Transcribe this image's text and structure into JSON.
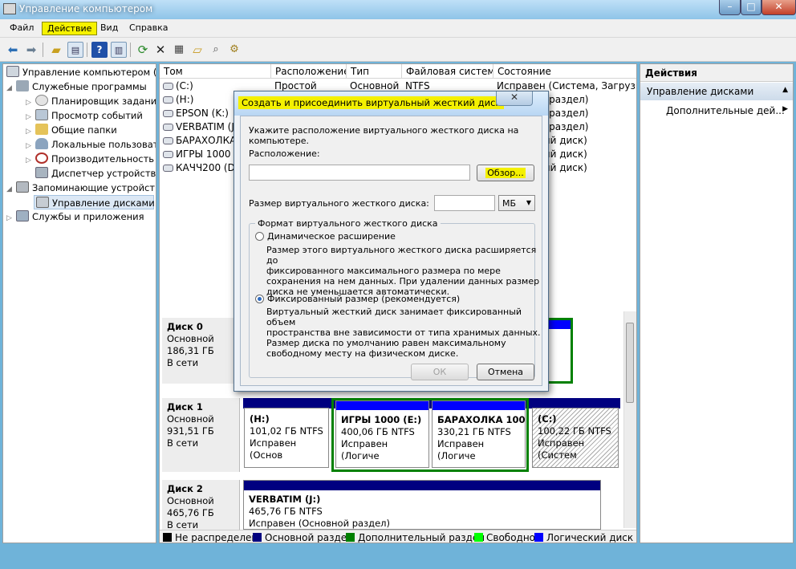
{
  "window": {
    "title": "Управление компьютером",
    "controls": {
      "minimize": "–",
      "maximize": "□",
      "close": "✕"
    }
  },
  "menu": [
    "Файл",
    "Действие",
    "Вид",
    "Справка"
  ],
  "toolbar": {
    "icons": [
      "back-icon",
      "forward-icon",
      "up-folder-icon",
      "show-tree-icon",
      "help-icon",
      "show-action-pane-icon",
      "refresh-icon",
      "delete-icon",
      "properties-icon",
      "open-folder-icon",
      "search-disk-icon",
      "disk-settings-icon"
    ]
  },
  "tree": {
    "root": "Управление компьютером (л",
    "items": [
      {
        "label": "Служебные программы",
        "level": 1
      },
      {
        "label": "Планировщик заданий",
        "level": 2
      },
      {
        "label": "Просмотр событий",
        "level": 2
      },
      {
        "label": "Общие папки",
        "level": 2
      },
      {
        "label": "Локальные пользоват",
        "level": 2
      },
      {
        "label": "Производительность",
        "level": 2
      },
      {
        "label": "Диспетчер устройств",
        "level": 2
      },
      {
        "label": "Запоминающие устройст",
        "level": 1
      },
      {
        "label": "Управление дисками",
        "level": 2
      },
      {
        "label": "Службы и приложения",
        "level": 1
      }
    ]
  },
  "volume_list": {
    "columns": [
      "Том",
      "Расположение",
      "Тип",
      "Файловая система",
      "Состояние"
    ],
    "rows": [
      {
        "tom": "(C:)",
        "loc": "Простой",
        "type": "Основной",
        "fs": "NTFS",
        "state": "Исправен (Система, Загрузка, С"
      },
      {
        "tom": "(H:)",
        "loc": "",
        "type": "",
        "fs": "",
        "state": "Основной раздел)"
      },
      {
        "tom": "EPSON (K:)",
        "loc": "",
        "type": "",
        "fs": "",
        "state": "Основной раздел)"
      },
      {
        "tom": "VERBATIM (J:)",
        "loc": "",
        "type": "",
        "fs": "",
        "state": "Основной раздел)"
      },
      {
        "tom": "БАРАХОЛКА",
        "loc": "",
        "type": "",
        "fs": "",
        "state": "Логический диск)"
      },
      {
        "tom": "ИГРЫ 1000 (E",
        "loc": "",
        "type": "",
        "fs": "",
        "state": "Логический диск)"
      },
      {
        "tom": "КАЧЧ200 (D:)",
        "loc": "",
        "type": "",
        "fs": "",
        "state": "Логический диск)"
      }
    ]
  },
  "disks": [
    {
      "name": "Диск 0",
      "kind": "Основной",
      "size": "186,31 ГБ",
      "status": "В сети"
    },
    {
      "name": "Диск 1",
      "kind": "Основной",
      "size": "931,51 ГБ",
      "status": "В сети",
      "partitions": [
        {
          "name": "(H:)",
          "size": "101,02 ГБ NTFS",
          "status": "Исправен (Основ"
        },
        {
          "name": "ИГРЫ 1000 (E:)",
          "size": "400,06 ГБ NTFS",
          "status": "Исправен (Логиче"
        },
        {
          "name": "БАРАХОЛКА 1000",
          "size": "330,21 ГБ NTFS",
          "status": "Исправен (Логиче"
        },
        {
          "name": "(C:)",
          "size": "100,22 ГБ NTFS",
          "status": "Исправен (Систем"
        }
      ]
    },
    {
      "name": "Диск 2",
      "kind": "Основной",
      "size": "465,76 ГБ",
      "status": "В сети",
      "partitions": [
        {
          "name": "VERBATIM (J:)",
          "size": "465,76 ГБ NTFS",
          "status": "Исправен (Основной раздел)"
        }
      ]
    }
  ],
  "legend": [
    {
      "label": "Не распределен",
      "color": "#000000"
    },
    {
      "label": "Основной раздел",
      "color": "#00007f"
    },
    {
      "label": "Дополнительный раздел",
      "color": "#008000"
    },
    {
      "label": "Свободно",
      "color": "#00ff00"
    },
    {
      "label": "Логический диск",
      "color": "#0000ff"
    }
  ],
  "actions": {
    "header": "Действия",
    "section": "Управление дисками",
    "item": "Дополнительные дей..."
  },
  "dialog": {
    "title": "Создать и присоединить виртуальный жесткий диск",
    "intro_line1": "Укажите расположение виртуального жесткого диска на",
    "intro_line2": "компьютере.",
    "location_label": "Расположение:",
    "location_value": "",
    "browse": "Обзор...",
    "size_label": "Размер виртуального жесткого диска:",
    "size_value": "",
    "unit": "МБ",
    "format_group": "Формат виртуального жесткого диска",
    "dynamic": {
      "label": "Динамическое расширение",
      "selected": false,
      "desc": [
        "Размер этого виртуального жесткого диска расширяется до",
        "фиксированного максимального размера по мере",
        "сохранения на нем данных. При удалении данных размер",
        "диска не уменьшается автоматически."
      ]
    },
    "fixed": {
      "label": "Фиксированный размер (рекомендуется)",
      "selected": true,
      "desc": [
        "Виртуальный жесткий диск занимает фиксированный объем",
        "пространства вне зависимости от типа хранимых данных.",
        "Размер диска по умолчанию равен максимальному",
        "свободному месту на физическом диске."
      ]
    },
    "ok": "ОК",
    "cancel": "Отмена"
  }
}
